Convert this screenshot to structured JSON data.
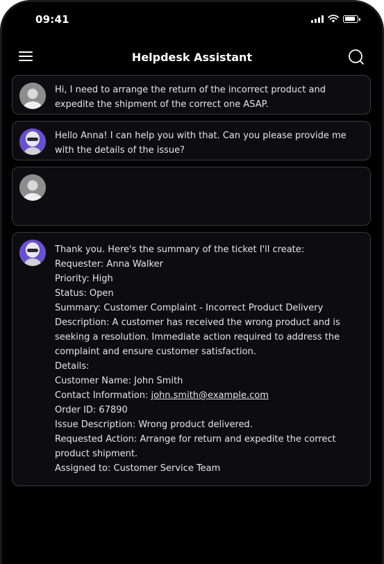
{
  "status_bar": {
    "time": "09:41"
  },
  "header": {
    "title": "Helpdesk Assistant"
  },
  "messages": [
    {
      "sender": "user",
      "lines": [
        "Hi, I need to arrange the return of the incorrect product and",
        "expedite the shipment of the correct one ASAP."
      ]
    },
    {
      "sender": "bot",
      "lines": [
        "Hello Anna! I can help you with that. Can you please provide me",
        "with the details of the issue?"
      ]
    },
    {
      "sender": "user",
      "lines": []
    },
    {
      "sender": "bot",
      "lines": [
        "Thank you. Here's the summary of the ticket I'll create:",
        "Requester: Anna Walker",
        "Priority: High",
        "Status: Open",
        "Summary: Customer Complaint - Incorrect Product Delivery",
        "Description: A customer has received the wrong product and is",
        "seeking a resolution. Immediate action required to address the",
        "complaint and ensure customer satisfaction.",
        "Details:",
        "Customer Name: John Smith",
        "Contact Information: ",
        "Order ID: 67890",
        "Issue Description: Wrong product delivered.",
        "Requested Action: Arrange for return and expedite the correct",
        "product shipment.",
        "Assigned to: Customer Service Team"
      ],
      "contact_email": "john.smith@example.com"
    }
  ],
  "icons": {
    "menu": "menu-icon",
    "search": "search-icon",
    "signal": "signal-icon",
    "wifi": "wifi-icon",
    "battery": "battery-icon"
  },
  "colors": {
    "background": "#000000",
    "bubble": "#0d0d0f",
    "bubble_border": "#3a3a3e",
    "bot_avatar": "#6b4fd1"
  }
}
